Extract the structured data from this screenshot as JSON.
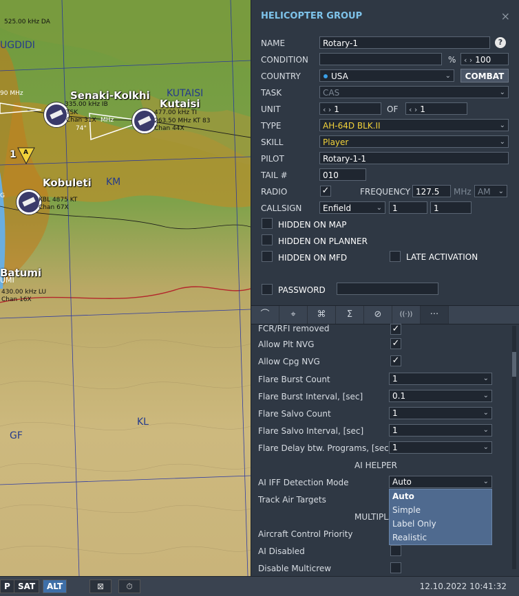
{
  "map": {
    "labels": {
      "freq_top": "525.00 kHz DA",
      "ugdidi": "UGDIDI",
      "freq_left": "90 MHz",
      "senaki": "Senaki-Kolkhi",
      "kutaisi_region": "KUTAISI",
      "kutaisi": "Kutaisi",
      "senaki_info1": "335.00 kHz IB",
      "senaki_info2": "TSK",
      "senaki_info3": "Chan 31X",
      "senaki_info4": "MHz",
      "senaki_heading": "74°",
      "kutaisi_info1": "477.00 kHz TI",
      "kutaisi_info2": "263.50 MHz KT 83",
      "kutaisi_info3": "Chan 44X",
      "kobuleti": "Kobuleti",
      "km": "KM",
      "kobuleti_info1": "KBL 4875 KT",
      "kobuleti_info2": "Chan 67X",
      "batumi": "Batumi",
      "batumi_info1": "430.00 kHz LU",
      "batumi_info2": "Chan 16X",
      "umi": "UMI",
      "kl": "KL",
      "gf": "GF",
      "marker_num": "1",
      "marker_letter": "A",
      "g": "G"
    }
  },
  "bottombar": {
    "btn_p": "P",
    "btn_sat": "SAT",
    "btn_alt": "ALT",
    "icon1": "⊠",
    "icon2": "⏱",
    "datetime": "12.10.2022 10:41:32"
  },
  "panel": {
    "title": "HELICOPTER GROUP",
    "close": "×",
    "help": "?",
    "name_label": "NAME",
    "name_value": "Rotary-1",
    "condition_label": "CONDITION",
    "condition_value": "",
    "percent": "%",
    "condition_num": "100",
    "country_label": "COUNTRY",
    "country_value": "USA",
    "combat_button": "COMBAT",
    "task_label": "TASK",
    "task_value": "CAS",
    "unit_label": "UNIT",
    "unit_value": "1",
    "of_label": "OF",
    "unit_of_value": "1",
    "type_label": "TYPE",
    "type_value": "AH-64D BLK.II",
    "skill_label": "SKILL",
    "skill_value": "Player",
    "pilot_label": "PILOT",
    "pilot_value": "Rotary-1-1",
    "tail_label": "TAIL #",
    "tail_value": "010",
    "radio_label": "RADIO",
    "frequency_label": "FREQUENCY",
    "frequency_value": "127.5",
    "mhz": "MHz",
    "modulation": "AM",
    "callsign_label": "CALLSIGN",
    "callsign_value": "Enfield",
    "callsign_num1": "1",
    "callsign_num2": "1",
    "hidden_map": "HIDDEN ON MAP",
    "hidden_planner": "HIDDEN ON PLANNER",
    "hidden_mfd": "HIDDEN ON MFD",
    "late_activation": "LATE ACTIVATION",
    "password": "PASSWORD",
    "password_value": "",
    "tabs": [
      "⌒",
      "⌖",
      "⌘",
      "Σ",
      "⊘",
      "((·))",
      "···"
    ]
  },
  "options": {
    "fcr": "FCR/RFI removed",
    "allow_plt": "Allow Plt NVG",
    "allow_cpg": "Allow Cpg NVG",
    "flare_burst_count": "Flare Burst Count",
    "flare_burst_count_val": "1",
    "flare_burst_interval": "Flare Burst Interval, [sec]",
    "flare_burst_interval_val": "0.1",
    "flare_salvo_count": "Flare Salvo Count",
    "flare_salvo_count_val": "1",
    "flare_salvo_interval": "Flare Salvo Interval, [sec]",
    "flare_salvo_interval_val": "1",
    "flare_delay": "Flare Delay btw. Programs, [sec]",
    "flare_delay_val": "1",
    "ai_helper": "AI HELPER",
    "ai_iff": "AI IFF Detection Mode",
    "ai_iff_val": "Auto",
    "track_air": "Track Air Targets",
    "multiplayer": "MULTIPLA",
    "aircraft_control": "Aircraft Control Priority",
    "ai_disabled": "AI Disabled",
    "disable_multicrew": "Disable Multicrew",
    "dropdown": [
      "Auto",
      "Simple",
      "Label Only",
      "Realistic"
    ]
  },
  "colors": {
    "accent": "#7ec3ea",
    "highlight_text": "#f2d23a",
    "country_dot": "#3aa0e8",
    "dropdown_bg": "#4f6a8f"
  }
}
